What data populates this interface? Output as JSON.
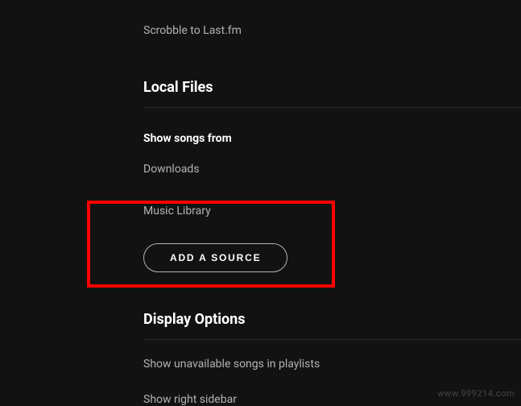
{
  "settings": {
    "scrobble": "Scrobble to Last.fm"
  },
  "local_files": {
    "heading": "Local Files",
    "show_songs_from": "Show songs from",
    "sources": {
      "downloads": "Downloads",
      "music_library": "Music Library"
    },
    "add_source_button": "ADD A SOURCE"
  },
  "display_options": {
    "heading": "Display Options",
    "unavailable_songs": "Show unavailable songs in playlists",
    "right_sidebar": "Show right sidebar"
  },
  "watermark": "www.999214.com"
}
